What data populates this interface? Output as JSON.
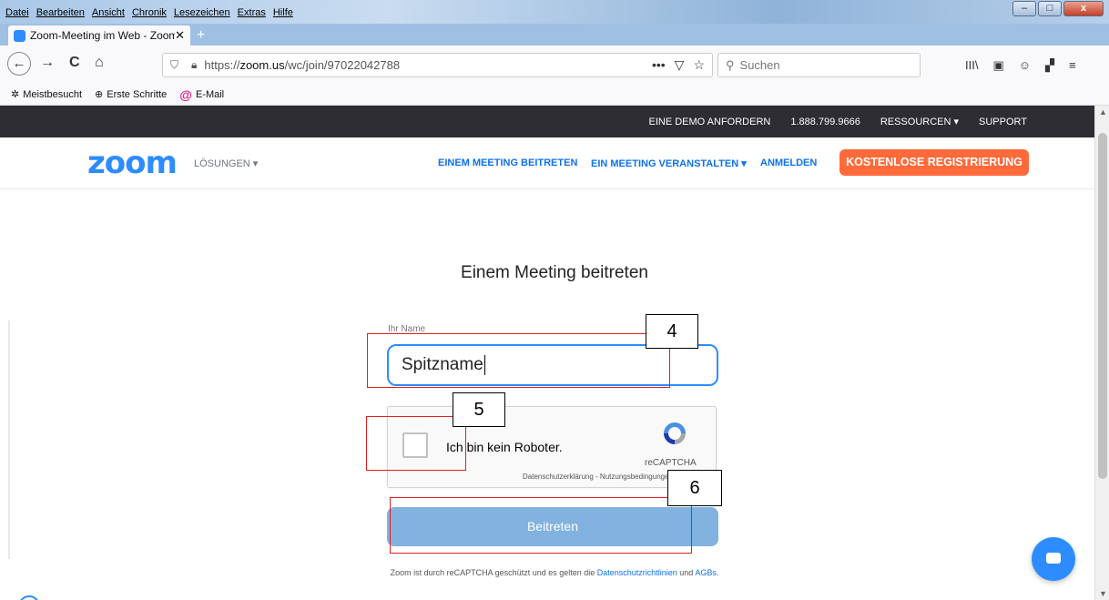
{
  "menubar": [
    "Datei",
    "Bearbeiten",
    "Ansicht",
    "Chronik",
    "Lesezeichen",
    "Extras",
    "Hilfe"
  ],
  "window_controls": {
    "minimize": "–",
    "maximize": "□",
    "close": "x"
  },
  "tab": {
    "title": "Zoom-Meeting im Web - Zoom",
    "close": "✕",
    "new_tab": "+"
  },
  "nav": {
    "back": "←",
    "forward": "→",
    "reload": "C",
    "home": "⌂",
    "url_host_prefix": "https://",
    "url_host": "zoom.us",
    "url_path": "/wc/join/97022042788",
    "page_actions": [
      "•••",
      "▽",
      "☆"
    ],
    "search_placeholder": "Suchen",
    "toolbar_icons": [
      "III\\",
      "▣",
      "☺",
      "≡"
    ]
  },
  "bookmarks": [
    {
      "label": "Meistbesucht",
      "icon": "gear-icon"
    },
    {
      "label": "Erste Schritte",
      "icon": "globe-icon"
    },
    {
      "label": "E-Mail",
      "icon": "at-icon"
    }
  ],
  "zoom_topnav": [
    "EINE DEMO ANFORDERN",
    "1.888.799.9666",
    "RESSOURCEN ▾",
    "SUPPORT"
  ],
  "zoom_header": {
    "logo": "zoom",
    "solutions": "LÖSUNGEN ▾",
    "join": "EINEM MEETING BEITRETEN",
    "host": "EIN MEETING VERANSTALTEN ▾",
    "signin": "ANMELDEN",
    "signup": "KOSTENLOSE REGISTRIERUNG"
  },
  "form": {
    "heading": "Einem Meeting beitreten",
    "name_label": "Ihr Name",
    "name_value": "Spitzname",
    "captcha_label": "Ich bin kein Roboter.",
    "captcha_brand": "reCAPTCHA",
    "captcha_links": "Datenschutzerklärung - Nutzungsbedingungen",
    "join_button": "Beitreten",
    "legal_prefix": "Zoom ist durch reCAPTCHA geschützt und es gelten die ",
    "legal_link1": "Datenschutzrichtlinien",
    "legal_mid": " und ",
    "legal_link2": "AGBs",
    "legal_suffix": "."
  },
  "annotations": [
    "4",
    "5",
    "6"
  ],
  "colors": {
    "zoom_blue": "#2d8cff",
    "signup_orange": "#ff6a3b",
    "join_button": "#81b2e0",
    "annotation_red": "#e02020"
  }
}
